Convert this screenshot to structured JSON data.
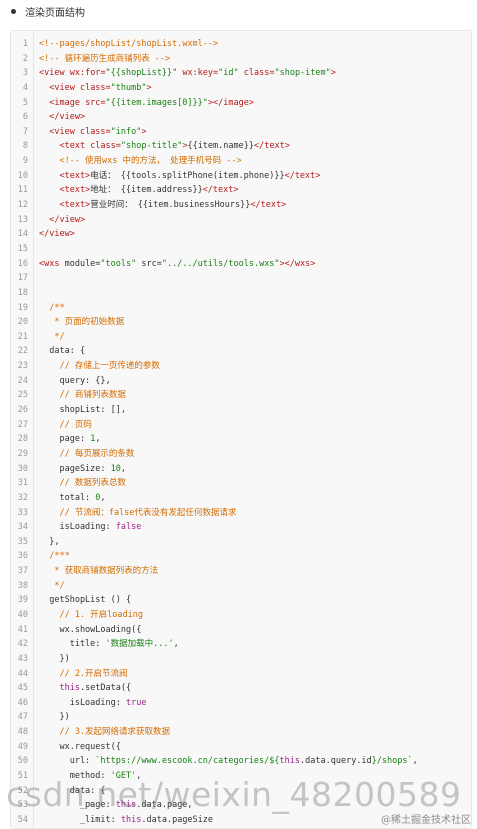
{
  "heading": "渲染页面结构",
  "code_lines": [
    [
      {
        "t": "<!--pages/shopList/shopList.wxml-->",
        "c": "#d26b00"
      }
    ],
    [
      {
        "t": "<!-- 循环遍历生成商铺列表 -->",
        "c": "#d26b00"
      }
    ],
    [
      {
        "t": "<view ",
        "c": "#b5191a"
      },
      {
        "t": "wx:for=",
        "c": "#b5191a"
      },
      {
        "t": "\"{{shopList}}\"",
        "c": "#1a8014"
      },
      {
        "t": " wx:key=",
        "c": "#b5191a"
      },
      {
        "t": "\"id\"",
        "c": "#1a8014"
      },
      {
        "t": " class=",
        "c": "#b5191a"
      },
      {
        "t": "\"shop-item\"",
        "c": "#1a8014"
      },
      {
        "t": ">",
        "c": "#b5191a"
      }
    ],
    [
      {
        "t": "  <view ",
        "c": "#b5191a"
      },
      {
        "t": "class=",
        "c": "#b5191a"
      },
      {
        "t": "\"thumb\"",
        "c": "#1a8014"
      },
      {
        "t": ">",
        "c": "#b5191a"
      }
    ],
    [
      {
        "t": "  <image ",
        "c": "#b5191a"
      },
      {
        "t": "src=",
        "c": "#b5191a"
      },
      {
        "t": "\"{{item.images[0]}}\"",
        "c": "#1a8014"
      },
      {
        "t": "></image>",
        "c": "#b5191a"
      }
    ],
    [
      {
        "t": "  </view>",
        "c": "#b5191a"
      }
    ],
    [
      {
        "t": "  <view ",
        "c": "#b5191a"
      },
      {
        "t": "class=",
        "c": "#b5191a"
      },
      {
        "t": "\"info\"",
        "c": "#1a8014"
      },
      {
        "t": ">",
        "c": "#b5191a"
      }
    ],
    [
      {
        "t": "    <text ",
        "c": "#b5191a"
      },
      {
        "t": "class=",
        "c": "#b5191a"
      },
      {
        "t": "\"shop-title\"",
        "c": "#1a8014"
      },
      {
        "t": ">",
        "c": "#b5191a"
      },
      {
        "t": "{{item.name}}",
        "c": "#333333"
      },
      {
        "t": "</text>",
        "c": "#b5191a"
      }
    ],
    [
      {
        "t": "    <!-- 使用wxs 中的方法， 处理手机号码 -->",
        "c": "#d26b00"
      }
    ],
    [
      {
        "t": "    <text>",
        "c": "#b5191a"
      },
      {
        "t": "电话： {{tools.splitPhone(item.phone)}}",
        "c": "#333333"
      },
      {
        "t": "</text>",
        "c": "#b5191a"
      }
    ],
    [
      {
        "t": "    <text>",
        "c": "#b5191a"
      },
      {
        "t": "地址： {{item.address}}",
        "c": "#333333"
      },
      {
        "t": "</text>",
        "c": "#b5191a"
      }
    ],
    [
      {
        "t": "    <text>",
        "c": "#b5191a"
      },
      {
        "t": "营业时间： {{item.businessHours}}",
        "c": "#333333"
      },
      {
        "t": "</text>",
        "c": "#b5191a"
      }
    ],
    [
      {
        "t": "  </view>",
        "c": "#b5191a"
      }
    ],
    [
      {
        "t": "</view>",
        "c": "#b5191a"
      }
    ],
    [],
    [
      {
        "t": "<wxs ",
        "c": "#b5191a"
      },
      {
        "t": "module=",
        "c": "#333333"
      },
      {
        "t": "\"tools\"",
        "c": "#1a8014"
      },
      {
        "t": " src=",
        "c": "#333333"
      },
      {
        "t": "\"../../utils/tools.wxs\"",
        "c": "#1a8014"
      },
      {
        "t": "></wxs>",
        "c": "#b5191a"
      }
    ],
    [],
    [],
    [
      {
        "t": "  /**",
        "c": "#d26b00"
      }
    ],
    [
      {
        "t": "   * 页面的初始数据",
        "c": "#d26b00"
      }
    ],
    [
      {
        "t": "   */",
        "c": "#d26b00"
      }
    ],
    [
      {
        "t": "  data: {",
        "c": "#333333"
      }
    ],
    [
      {
        "t": "    // 存储上一页传递的参数",
        "c": "#d26b00"
      }
    ],
    [
      {
        "t": "    query: {},",
        "c": "#333333"
      }
    ],
    [
      {
        "t": "    // 商铺列表数据",
        "c": "#d26b00"
      }
    ],
    [
      {
        "t": "    shopList: [],",
        "c": "#333333"
      }
    ],
    [
      {
        "t": "    // 页码",
        "c": "#d26b00"
      }
    ],
    [
      {
        "t": "    page: ",
        "c": "#333333"
      },
      {
        "t": "1",
        "c": "#1a8014"
      },
      {
        "t": ",",
        "c": "#333333"
      }
    ],
    [
      {
        "t": "    // 每页展示的条数",
        "c": "#d26b00"
      }
    ],
    [
      {
        "t": "    pageSize: ",
        "c": "#333333"
      },
      {
        "t": "10",
        "c": "#1a8014"
      },
      {
        "t": ",",
        "c": "#333333"
      }
    ],
    [
      {
        "t": "    // 数据列表总数",
        "c": "#d26b00"
      }
    ],
    [
      {
        "t": "    total: ",
        "c": "#333333"
      },
      {
        "t": "0",
        "c": "#1a8014"
      },
      {
        "t": ",",
        "c": "#333333"
      }
    ],
    [
      {
        "t": "    // 节流阀：false代表没有发起任何数据请求",
        "c": "#d26b00"
      }
    ],
    [
      {
        "t": "    isLoading: ",
        "c": "#333333"
      },
      {
        "t": "false",
        "c": "#a01f8c"
      }
    ],
    [
      {
        "t": "  },",
        "c": "#333333"
      }
    ],
    [
      {
        "t": "  /***",
        "c": "#d26b00"
      }
    ],
    [
      {
        "t": "   * 获取商铺数据列表的方法",
        "c": "#d26b00"
      }
    ],
    [
      {
        "t": "   */",
        "c": "#d26b00"
      }
    ],
    [
      {
        "t": "  getShopList () {",
        "c": "#333333"
      }
    ],
    [
      {
        "t": "    // 1. 开启loading",
        "c": "#d26b00"
      }
    ],
    [
      {
        "t": "    wx.showLoading({",
        "c": "#333333"
      }
    ],
    [
      {
        "t": "      title: ",
        "c": "#333333"
      },
      {
        "t": "'数据加载中...'",
        "c": "#1a8014"
      },
      {
        "t": ",",
        "c": "#333333"
      }
    ],
    [
      {
        "t": "    })",
        "c": "#333333"
      }
    ],
    [
      {
        "t": "    // 2.开启节流阀",
        "c": "#d26b00"
      }
    ],
    [
      {
        "t": "    this",
        "c": "#a01f8c"
      },
      {
        "t": ".setData({",
        "c": "#333333"
      }
    ],
    [
      {
        "t": "      isLoading: ",
        "c": "#333333"
      },
      {
        "t": "true",
        "c": "#a01f8c"
      }
    ],
    [
      {
        "t": "    })",
        "c": "#333333"
      }
    ],
    [
      {
        "t": "    // 3.发起网络请求获取数据",
        "c": "#d26b00"
      }
    ],
    [
      {
        "t": "    wx.request({",
        "c": "#333333"
      }
    ],
    [
      {
        "t": "      url: ",
        "c": "#333333"
      },
      {
        "t": "`https://www.escook.cn/categories/${",
        "c": "#1a8014"
      },
      {
        "t": "this",
        "c": "#a01f8c"
      },
      {
        "t": ".data.query.id",
        "c": "#333333"
      },
      {
        "t": "}/shops`",
        "c": "#1a8014"
      },
      {
        "t": ",",
        "c": "#333333"
      }
    ],
    [
      {
        "t": "      method: ",
        "c": "#333333"
      },
      {
        "t": "'GET'",
        "c": "#1a8014"
      },
      {
        "t": ",",
        "c": "#333333"
      }
    ],
    [
      {
        "t": "      data: {",
        "c": "#333333"
      }
    ],
    [
      {
        "t": "        _page: ",
        "c": "#333333"
      },
      {
        "t": "this",
        "c": "#a01f8c"
      },
      {
        "t": ".data.page,",
        "c": "#333333"
      }
    ],
    [
      {
        "t": "        _limit: ",
        "c": "#333333"
      },
      {
        "t": "this",
        "c": "#a01f8c"
      },
      {
        "t": ".data.pageSize",
        "c": "#333333"
      }
    ],
    [
      {
        "t": "      },",
        "c": "#333333"
      }
    ]
  ],
  "watermark": "csdn.net/weixin_48200589",
  "badge": "@稀土掘金技术社区"
}
